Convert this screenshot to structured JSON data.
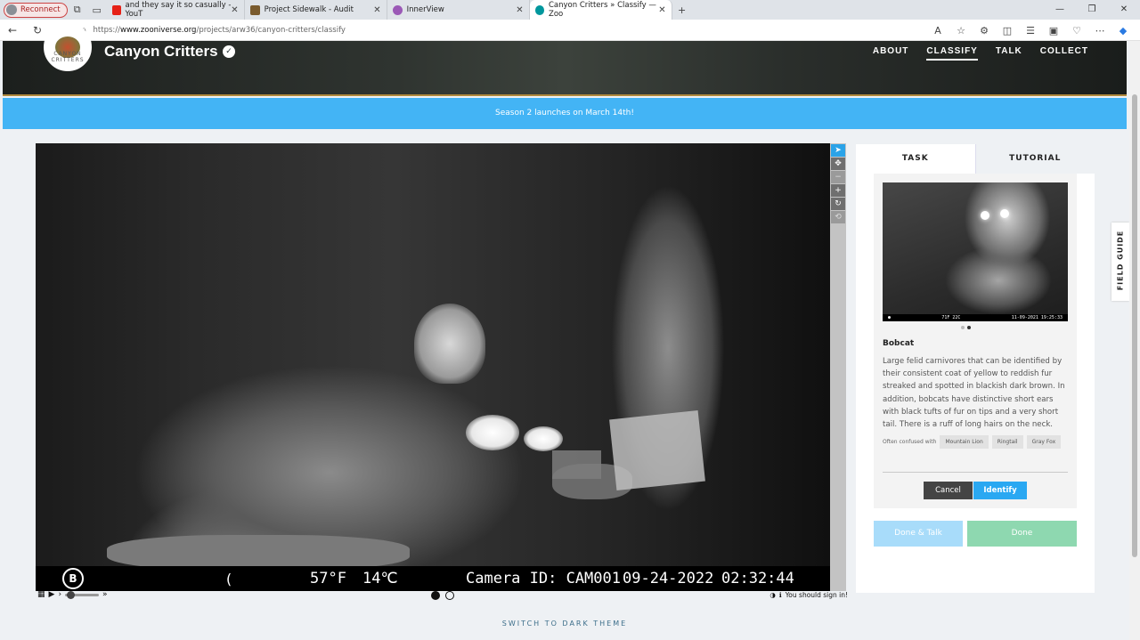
{
  "browser": {
    "reconnect_label": "Reconnect",
    "tabs": [
      {
        "title": "and they say it so casually - YouT",
        "favicon_color": "#e62117"
      },
      {
        "title": "Project Sidewalk - Audit",
        "favicon_color": "#7a5b2e"
      },
      {
        "title": "InnerView",
        "favicon_color": "#9b59b6"
      },
      {
        "title": "Canyon Critters » Classify — Zoo",
        "favicon_color": "#00979d"
      }
    ],
    "url_prefix": "https://",
    "url_domain": "www.zooniverse.org",
    "url_path": "/projects/arw36/canyon-critters/classify"
  },
  "site": {
    "project_title": "Canyon Critters",
    "logo_text": "CANYON CRITTERS",
    "nav": [
      "ABOUT",
      "CLASSIFY",
      "TALK",
      "COLLECT"
    ],
    "active_nav": "CLASSIFY",
    "banner": "Season 2 launches on March 14th!"
  },
  "subject": {
    "camera_logo": "B",
    "moon_symbol": "(",
    "temp_f": "57°F",
    "temp_c": "14℃",
    "camera_id": "Camera ID: CAM001",
    "date": "09-24-2022",
    "time": "02:32:44",
    "frame_count": 2,
    "current_frame": 1
  },
  "viewer_tools": [
    "pointer",
    "move",
    "zoom-out",
    "zoom-in",
    "rotate",
    "reset"
  ],
  "controls": {
    "signin_text": "You should sign in!",
    "dark_theme": "SWITCH TO DARK THEME"
  },
  "panel": {
    "tabs": [
      "TASK",
      "TUTORIAL"
    ],
    "thumb_strip_left": "71F 22C",
    "thumb_strip_right": "11-09-2021 19:25:33",
    "species_name": "Bobcat",
    "species_desc": "Large felid carnivores that can be identified by their consistent coat of yellow to reddish fur streaked and spotted in blackish dark brown. In addition, bobcats have distinctive short ears with black tufts of fur on tips and a very short tail. There is a ruff of long hairs on the neck.",
    "confused_label": "Often confused with",
    "confused_with": [
      "Mountain Lion",
      "Ringtail",
      "Gray Fox"
    ],
    "cancel": "Cancel",
    "identify": "Identify",
    "done_talk": "Done & Talk",
    "done": "Done",
    "field_guide": "FIELD GUIDE"
  }
}
